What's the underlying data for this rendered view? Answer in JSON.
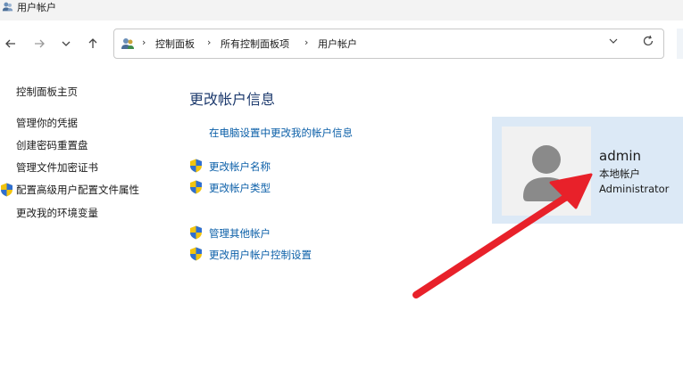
{
  "window": {
    "title": "用户帐户",
    "icon": "users-icon"
  },
  "nav": {
    "back_icon": "arrow-left-icon",
    "forward_icon": "arrow-right-icon",
    "recent_icon": "chevron-down-icon",
    "up_icon": "arrow-up-icon"
  },
  "address": {
    "location_icon": "users-icon",
    "crumbs": [
      "控制面板",
      "所有控制面板项",
      "用户帐户"
    ],
    "separator": "›",
    "dropdown_icon": "chevron-down-icon",
    "refresh_icon": "refresh-icon"
  },
  "sidebar": {
    "items": [
      {
        "label": "控制面板主页"
      },
      {
        "label": "管理你的凭据"
      },
      {
        "label": "创建密码重置盘"
      },
      {
        "label": "管理文件加密证书"
      },
      {
        "label": "配置高级用户配置文件属性",
        "icon": "uac-shield-icon"
      },
      {
        "label": "更改我的环境变量"
      }
    ]
  },
  "main": {
    "title": "更改帐户信息",
    "links": [
      {
        "label": "在电脑设置中更改我的帐户信息"
      },
      {
        "label": "更改帐户名称",
        "icon": "uac-shield-icon"
      },
      {
        "label": "更改帐户类型",
        "icon": "uac-shield-icon"
      },
      {
        "label": "管理其他帐户",
        "icon": "uac-shield-icon"
      },
      {
        "label": "更改用户帐户控制设置",
        "icon": "uac-shield-icon"
      }
    ]
  },
  "account": {
    "name": "admin",
    "type": "本地帐户",
    "role": "Administrator",
    "avatar_icon": "user-avatar-icon"
  },
  "annotation": {
    "arrow_color": "#e8212a"
  }
}
